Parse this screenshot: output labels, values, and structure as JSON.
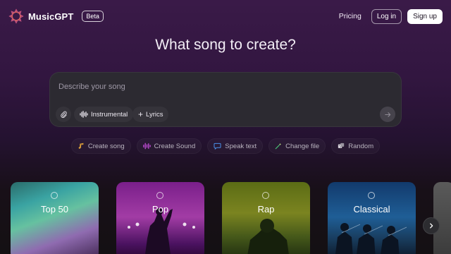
{
  "header": {
    "brand": "MusicGPT",
    "badge": "Beta",
    "nav": {
      "pricing": "Pricing",
      "login": "Log in",
      "signup": "Sign up"
    }
  },
  "hero": {
    "title": "What song to create?"
  },
  "prompt": {
    "placeholder": "Describe your song",
    "tools": {
      "instrumental": "Instrumental",
      "lyrics": "Lyrics"
    }
  },
  "actions": [
    {
      "label": "Create song",
      "icon": "music-note-icon",
      "color": "#e0a23a"
    },
    {
      "label": "Create Sound",
      "icon": "soundwave-icon",
      "color": "#c04bd6"
    },
    {
      "label": "Speak text",
      "icon": "speech-bubble-icon",
      "color": "#4a8fe8"
    },
    {
      "label": "Change file",
      "icon": "magic-wand-icon",
      "color": "#4bd07a"
    },
    {
      "label": "Random",
      "icon": "dice-icon",
      "color": "#d9d4dd"
    }
  ],
  "genres": [
    {
      "label": "Top 50"
    },
    {
      "label": "Pop"
    },
    {
      "label": "Rap"
    },
    {
      "label": "Classical"
    }
  ],
  "colors": {
    "accent": "#ffffff",
    "bg_top": "#3a1a48",
    "bg_bottom": "#141013"
  }
}
